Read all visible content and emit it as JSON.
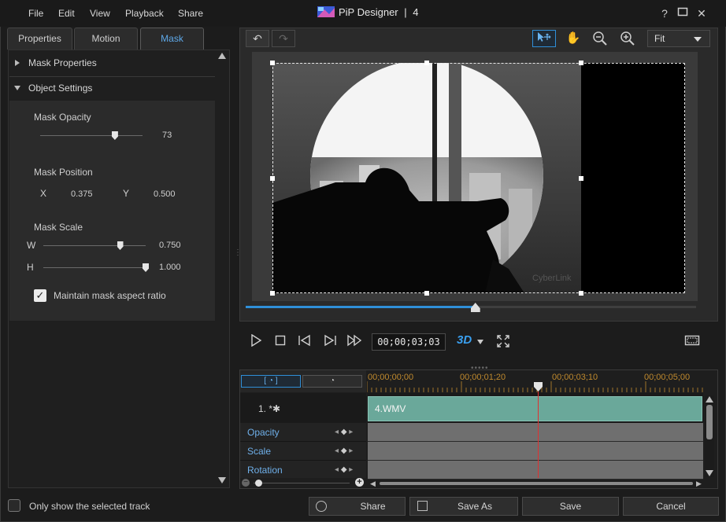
{
  "app": {
    "title": "PiP Designer",
    "separator": "|",
    "number": "4"
  },
  "menu": [
    "File",
    "Edit",
    "View",
    "Playback",
    "Share"
  ],
  "window_controls": {
    "help": "?",
    "maximize": "□",
    "close": "✕"
  },
  "tabs": [
    {
      "label": "Properties",
      "active": false
    },
    {
      "label": "Motion",
      "active": false
    },
    {
      "label": "Mask",
      "active": true
    }
  ],
  "panel": {
    "mask_properties": "Mask Properties",
    "object_settings": "Object Settings",
    "mask_opacity": {
      "label": "Mask Opacity",
      "value": "73",
      "level": 0.73
    },
    "mask_position": {
      "label": "Mask Position",
      "x_label": "X",
      "x_value": "0.375",
      "y_label": "Y",
      "y_value": "0.500"
    },
    "mask_scale": {
      "label": "Mask Scale",
      "w_label": "W",
      "w_value": "0.750",
      "w_level": 0.75,
      "h_label": "H",
      "h_value": "1.000",
      "h_level": 1.0
    },
    "maintain_aspect": {
      "label": "Maintain mask aspect ratio",
      "checked": true
    }
  },
  "preview": {
    "fit_option": "Fit",
    "progress": 0.51,
    "timecode": "00;00;03;03",
    "watermark": "CyberLink"
  },
  "timeline": {
    "ruler": [
      "00;00;00;00",
      "00;00;01;20",
      "00;00;03;10",
      "00;00;05;00"
    ],
    "track_name": "1. *✱",
    "clip_name": "4.WMV",
    "property_tracks": [
      "Opacity",
      "Scale",
      "Rotation"
    ]
  },
  "footer": {
    "only_selected": "Only show the selected track",
    "share": "Share",
    "save_as": "Save As",
    "save": "Save",
    "cancel": "Cancel"
  },
  "colors": {
    "accent": "#2f8fd8",
    "clip": "#6aa89a",
    "playhead": "#e03030",
    "ruler": "#c08a2e"
  }
}
